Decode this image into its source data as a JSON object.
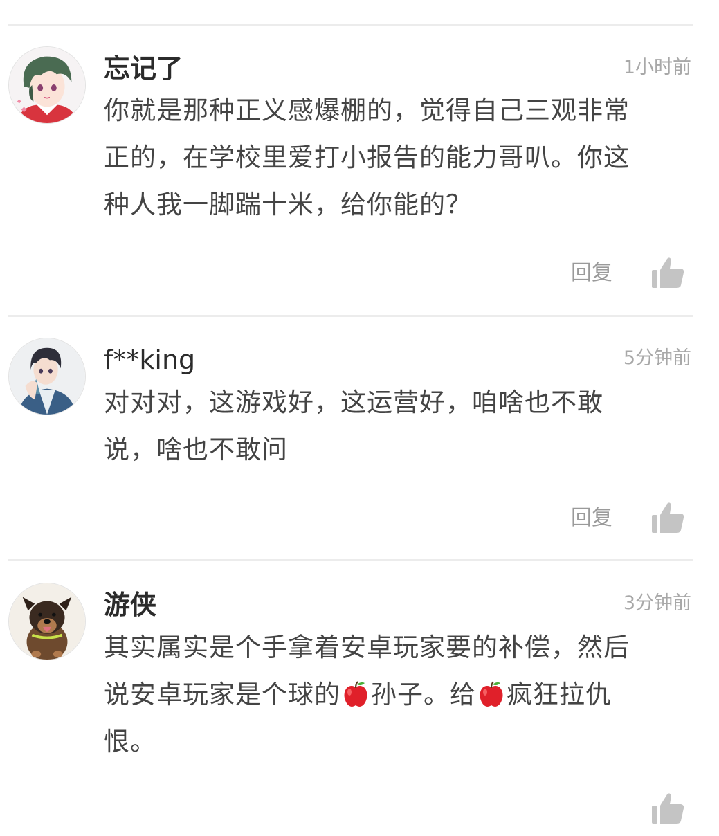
{
  "comments": [
    {
      "username": "忘记了",
      "time": "1小时前",
      "lines": [
        "你就是那种正义感爆棚的，觉得自己三观非常",
        "正的，在学校里爱打小报告的能力哥叭。你这",
        "种人我一脚踹十米，给你能的？"
      ],
      "reply_label": "回复",
      "avatar_icon": "anime-boy-avatar",
      "like_icon": "thumbs-up-icon"
    },
    {
      "username": "f**king",
      "time": "5分钟前",
      "lines": [
        "对对对，这游戏好，这运营好，咱啥也不敢",
        "说，啥也不敢问"
      ],
      "reply_label": "回复",
      "avatar_icon": "anime-boy-jacket-avatar",
      "like_icon": "thumbs-up-icon"
    },
    {
      "username": "游侠",
      "time": "3分钟前",
      "line1": "其实属实是个手拿着安卓玩家要的补偿，然后",
      "line2_a": "说安卓玩家是个球的",
      "line2_b": "孙子。给",
      "line2_c": "疯狂拉仇",
      "line3": "恨。",
      "emoji_icon": "red-apple-emoji",
      "avatar_icon": "puppy-avatar",
      "like_icon": "thumbs-up-icon"
    }
  ],
  "colors": {
    "divider": "#ececec",
    "username": "#2b2b2b",
    "time": "#a8a8a8",
    "content": "#444444",
    "reply": "#9a9a9a",
    "like_icon": "#c4c4c4"
  }
}
